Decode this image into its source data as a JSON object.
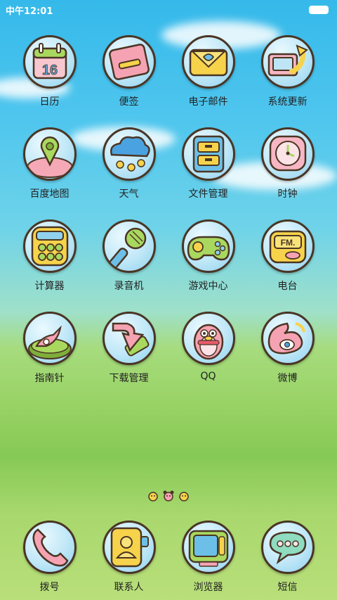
{
  "status_bar": {
    "time": "中午12:01"
  },
  "apps": [
    {
      "label": "日历",
      "icon": "calendar-icon"
    },
    {
      "label": "便签",
      "icon": "notes-icon"
    },
    {
      "label": "电子邮件",
      "icon": "email-icon"
    },
    {
      "label": "系统更新",
      "icon": "system-update-icon"
    },
    {
      "label": "百度地图",
      "icon": "map-icon"
    },
    {
      "label": "天气",
      "icon": "weather-icon"
    },
    {
      "label": "文件管理",
      "icon": "file-manager-icon"
    },
    {
      "label": "时钟",
      "icon": "clock-icon"
    },
    {
      "label": "计算器",
      "icon": "calculator-icon"
    },
    {
      "label": "录音机",
      "icon": "recorder-icon"
    },
    {
      "label": "游戏中心",
      "icon": "game-center-icon"
    },
    {
      "label": "电台",
      "icon": "radio-icon"
    },
    {
      "label": "指南针",
      "icon": "compass-icon"
    },
    {
      "label": "下载管理",
      "icon": "download-icon"
    },
    {
      "label": "QQ",
      "icon": "qq-icon"
    },
    {
      "label": "微博",
      "icon": "weibo-icon"
    }
  ],
  "calendar_day": "16",
  "radio_badge": "FM.",
  "dock": [
    {
      "label": "拨号",
      "icon": "phone-icon"
    },
    {
      "label": "联系人",
      "icon": "contacts-icon"
    },
    {
      "label": "浏览器",
      "icon": "browser-icon"
    },
    {
      "label": "短信",
      "icon": "messages-icon"
    }
  ],
  "page_indicator": {
    "count": 3,
    "current": 1
  }
}
